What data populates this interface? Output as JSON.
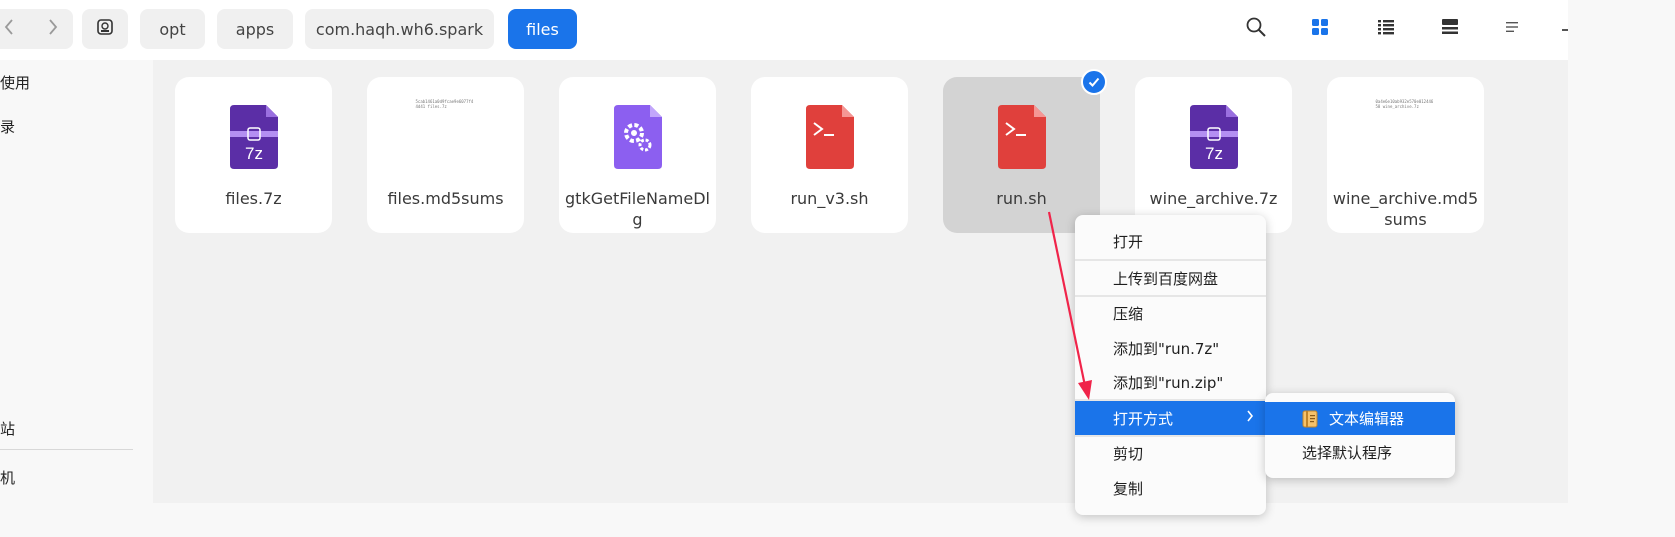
{
  "colors": {
    "accent": "#1a74ea",
    "annotation": "#f0244a"
  },
  "nav": {
    "back_icon": "chevron-left-icon",
    "forward_icon": "chevron-right-icon"
  },
  "breadcrumb": [
    {
      "label": "",
      "icon": "drive-icon"
    },
    {
      "label": "opt"
    },
    {
      "label": "apps"
    },
    {
      "label": "com.haqh.wh6.spark"
    },
    {
      "label": "files",
      "active": true
    }
  ],
  "toolbar": {
    "search_icon": "search-icon",
    "icon_view_icon": "grid-view-icon",
    "list_view_icon": "list-view-icon",
    "detail_view_icon": "detail-view-icon",
    "menu_icon": "menu-icon"
  },
  "sidebar": {
    "items": [
      {
        "label": "使用"
      },
      {
        "label": "录"
      },
      {
        "label": "站"
      },
      {
        "label": "机"
      }
    ]
  },
  "files": [
    {
      "name": "files.7z",
      "icon": "archive-7z-icon"
    },
    {
      "name": "files.md5sums",
      "icon": "text-thumbnail-icon",
      "preview": "5cab1461a0d9fcae9e6077f44d41  files.7z"
    },
    {
      "name": "gtkGetFileNameDlg",
      "icon": "executable-gear-icon"
    },
    {
      "name": "run_v3.sh",
      "icon": "shell-script-icon"
    },
    {
      "name": "run.sh",
      "icon": "shell-script-icon",
      "selected": true
    },
    {
      "name": "wine_archive.7z",
      "icon": "archive-7z-icon"
    },
    {
      "name": "wine_archive.md5sums",
      "icon": "text-thumbnail-icon",
      "preview": "0a4e6e10ab932e570e01244658  wine_archive.7z"
    }
  ],
  "context_menu": {
    "items": [
      {
        "label": "打开"
      },
      {
        "label": "上传到百度网盘"
      },
      {
        "label": "压缩"
      },
      {
        "label": "添加到\"run.7z\""
      },
      {
        "label": "添加到\"run.zip\""
      },
      {
        "label": "打开方式",
        "highlighted": true,
        "has_submenu": true
      },
      {
        "label": "剪切"
      },
      {
        "label": "复制"
      }
    ]
  },
  "submenu": {
    "items": [
      {
        "label": "文本编辑器",
        "icon": "text-editor-icon",
        "highlighted": true
      },
      {
        "label": "选择默认程序"
      }
    ]
  }
}
